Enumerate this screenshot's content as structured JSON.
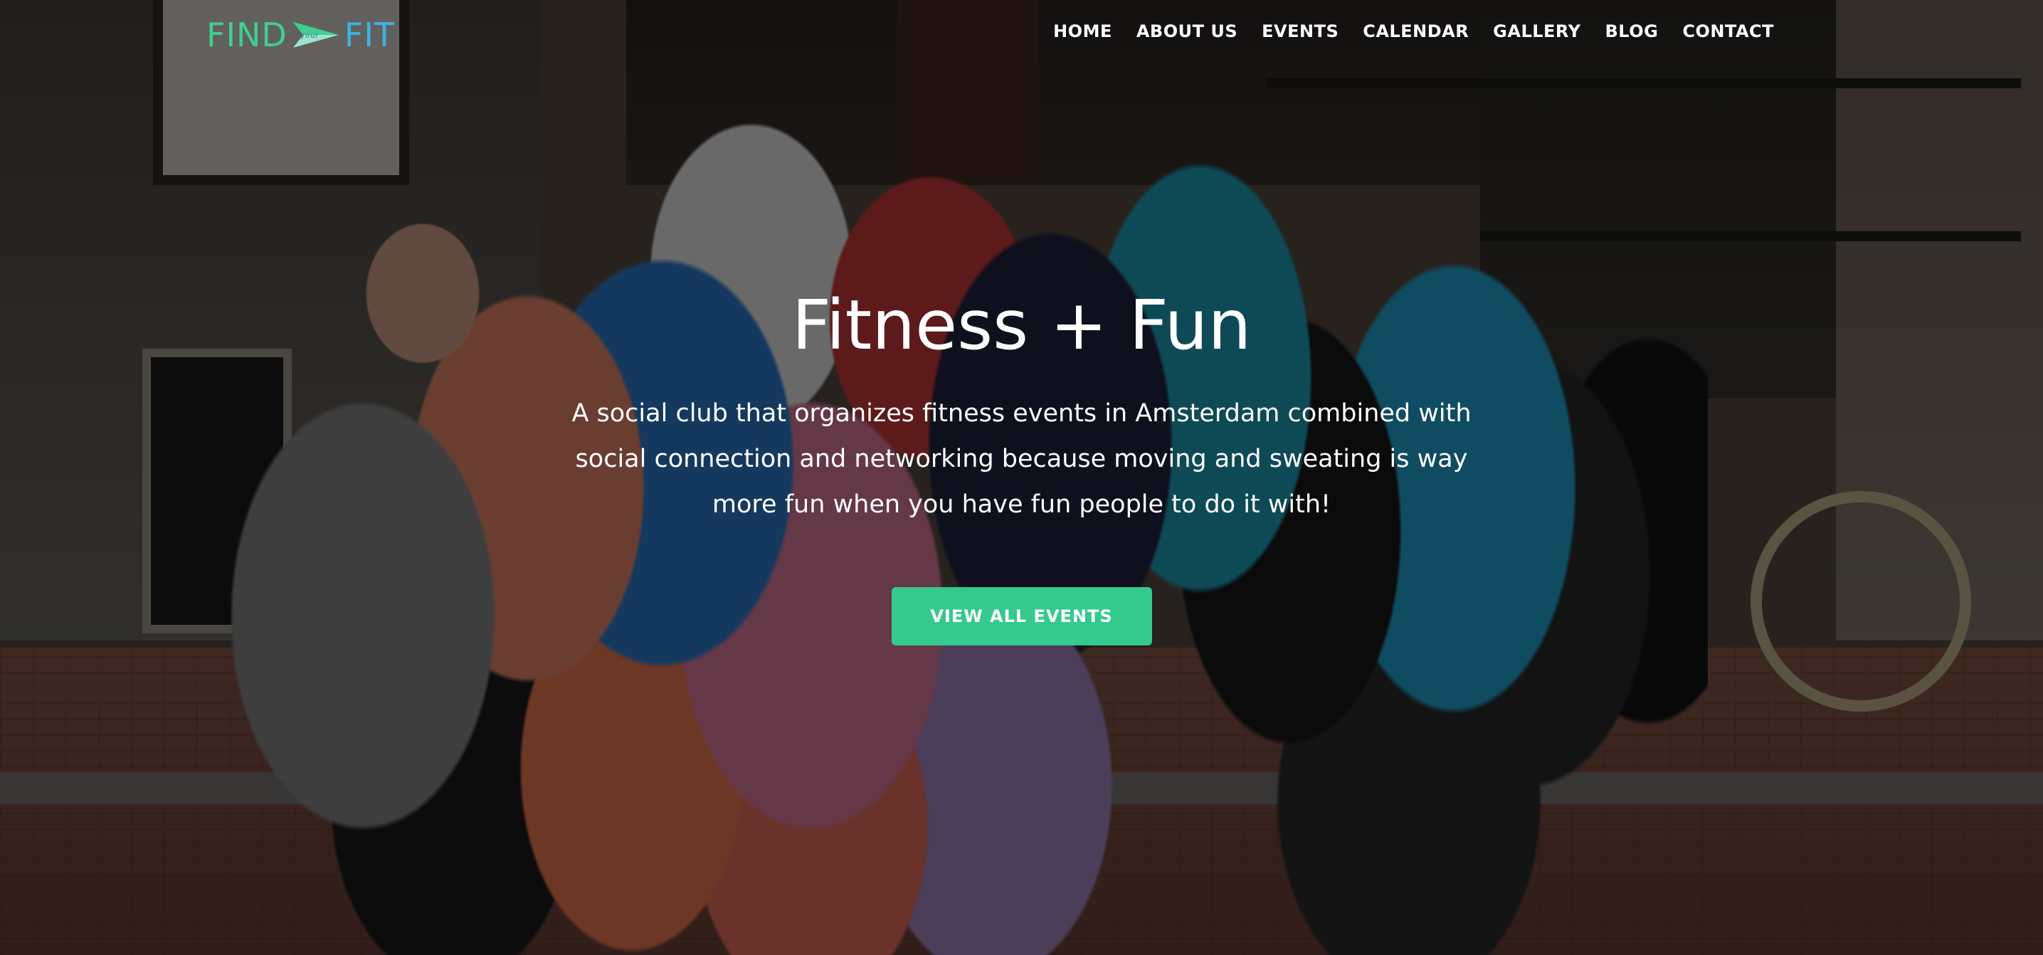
{
  "header": {
    "logo": {
      "text_left": "FIND",
      "text_small": "your",
      "text_right": "FIT",
      "color_left": "#3fcf8e",
      "color_right": "#3cb4e6",
      "icon": "arrow-icon"
    },
    "nav": [
      {
        "label": "HOME"
      },
      {
        "label": "ABOUT US"
      },
      {
        "label": "EVENTS"
      },
      {
        "label": "CALENDAR"
      },
      {
        "label": "GALLERY"
      },
      {
        "label": "BLOG"
      },
      {
        "label": "CONTACT"
      }
    ]
  },
  "hero": {
    "title": "Fitness + Fun",
    "subtitle": "A social club that organizes fitness events in Amsterdam combined with social connection and networking because moving and sweating is way more fun when you have fun people to do it with!",
    "cta_label": "VIEW ALL EVENTS",
    "accent_color": "#35c98e",
    "background": "group-photo-amsterdam-street"
  }
}
